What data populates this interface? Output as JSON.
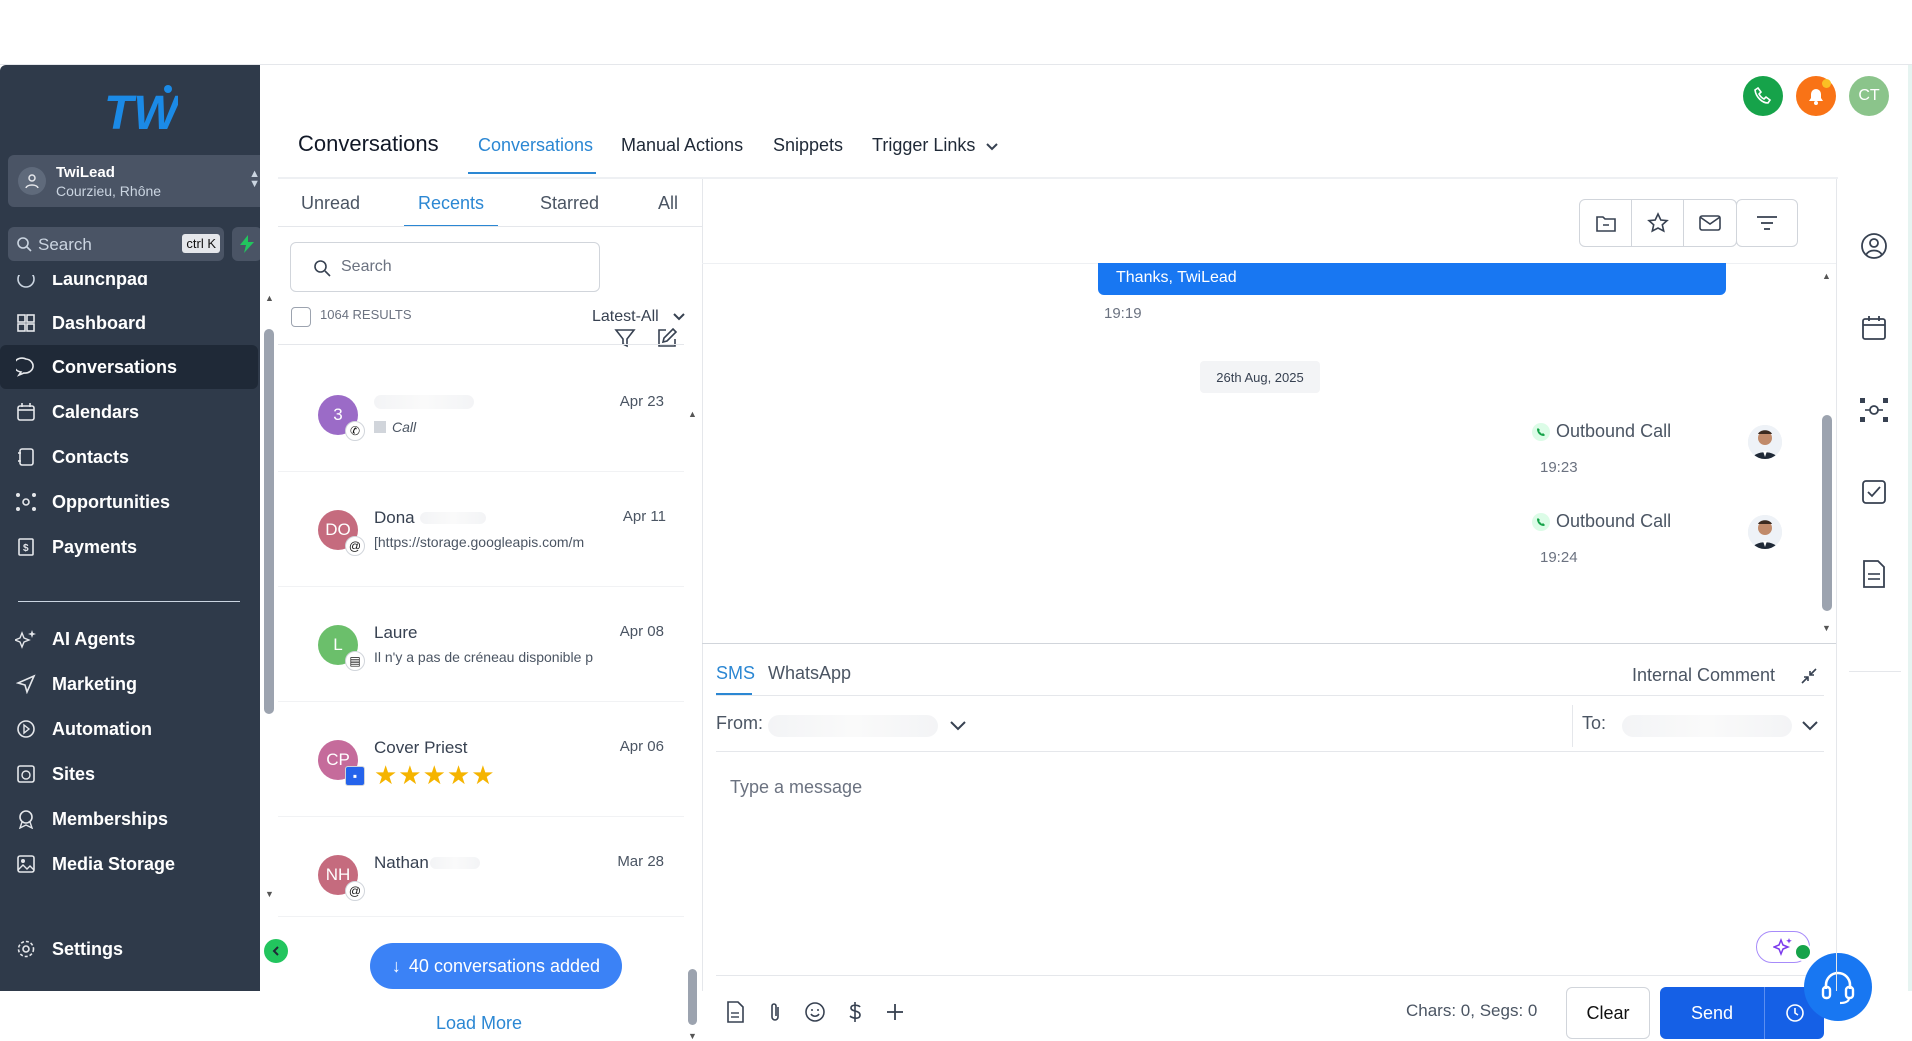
{
  "sidebar": {
    "account": {
      "name": "TwiLead",
      "location": "Courzieu, Rhône"
    },
    "search": {
      "placeholder": "Search",
      "shortcut": "ctrl K"
    },
    "items": [
      {
        "label": "Launchpad",
        "icon": "rocket-icon"
      },
      {
        "label": "Dashboard",
        "icon": "dashboard-icon"
      },
      {
        "label": "Conversations",
        "icon": "chat-bubble-icon",
        "active": true
      },
      {
        "label": "Calendars",
        "icon": "calendar-icon"
      },
      {
        "label": "Contacts",
        "icon": "contacts-icon"
      },
      {
        "label": "Opportunities",
        "icon": "opportunities-icon"
      },
      {
        "label": "Payments",
        "icon": "payments-icon"
      }
    ],
    "items2": [
      {
        "label": "AI Agents",
        "icon": "sparkle-icon"
      },
      {
        "label": "Marketing",
        "icon": "send-icon"
      },
      {
        "label": "Automation",
        "icon": "automation-icon"
      },
      {
        "label": "Sites",
        "icon": "globe-icon"
      },
      {
        "label": "Memberships",
        "icon": "badge-icon"
      },
      {
        "label": "Media Storage",
        "icon": "image-icon"
      }
    ],
    "settings": "Settings"
  },
  "header": {
    "avatar_initials": "CT",
    "page_title": "Conversations",
    "tabs": [
      "Conversations",
      "Manual Actions",
      "Snippets",
      "Trigger Links"
    ]
  },
  "list": {
    "tabs": [
      "Unread",
      "Recents",
      "Starred",
      "All"
    ],
    "search_placeholder": "Search",
    "results": "1064 RESULTS",
    "sort": "Latest-All",
    "conversations": [
      {
        "initials": "3",
        "name": "",
        "date": "Apr 23",
        "preview": "Call",
        "color": "#9b6bc7"
      },
      {
        "initials": "DO",
        "name": "Dona",
        "date": "Apr 11",
        "preview": "[https://storage.googleapis.com/m",
        "color": "#c56b7e"
      },
      {
        "initials": "L",
        "name": "Laure",
        "date": "Apr 08",
        "preview": "Il n'y a pas de créneau disponible p",
        "color": "#6bbf6b"
      },
      {
        "initials": "CP",
        "name": "Cover Priest",
        "date": "Apr 06",
        "preview": "★★★★★",
        "color": "#c56b9b"
      },
      {
        "initials": "NH",
        "name": "Nathan",
        "date": "Mar 28",
        "preview": "",
        "color": "#c56b7e"
      }
    ],
    "toast": "40 conversations added",
    "load_more": "Load More"
  },
  "chat": {
    "bubble": "Thanks, TwiLead",
    "bubble_time": "19:19",
    "date_divider": "26th Aug, 2025",
    "calls": [
      {
        "label": "Outbound Call",
        "time": "19:23"
      },
      {
        "label": "Outbound Call",
        "time": "19:24"
      }
    ]
  },
  "composer": {
    "tabs": [
      "SMS",
      "WhatsApp"
    ],
    "internal_comment": "Internal Comment",
    "from_label": "From:",
    "to_label": "To:",
    "placeholder": "Type a message",
    "counter": "Chars: 0, Segs: 0",
    "clear": "Clear",
    "send": "Send"
  },
  "colors": {
    "sidebar_bg": "#2f3a4a",
    "accent": "#2b87d3",
    "primary_button": "#1560e6",
    "phone": "#16a34a",
    "bell": "#f97316",
    "avatar": "#8bc48b"
  }
}
